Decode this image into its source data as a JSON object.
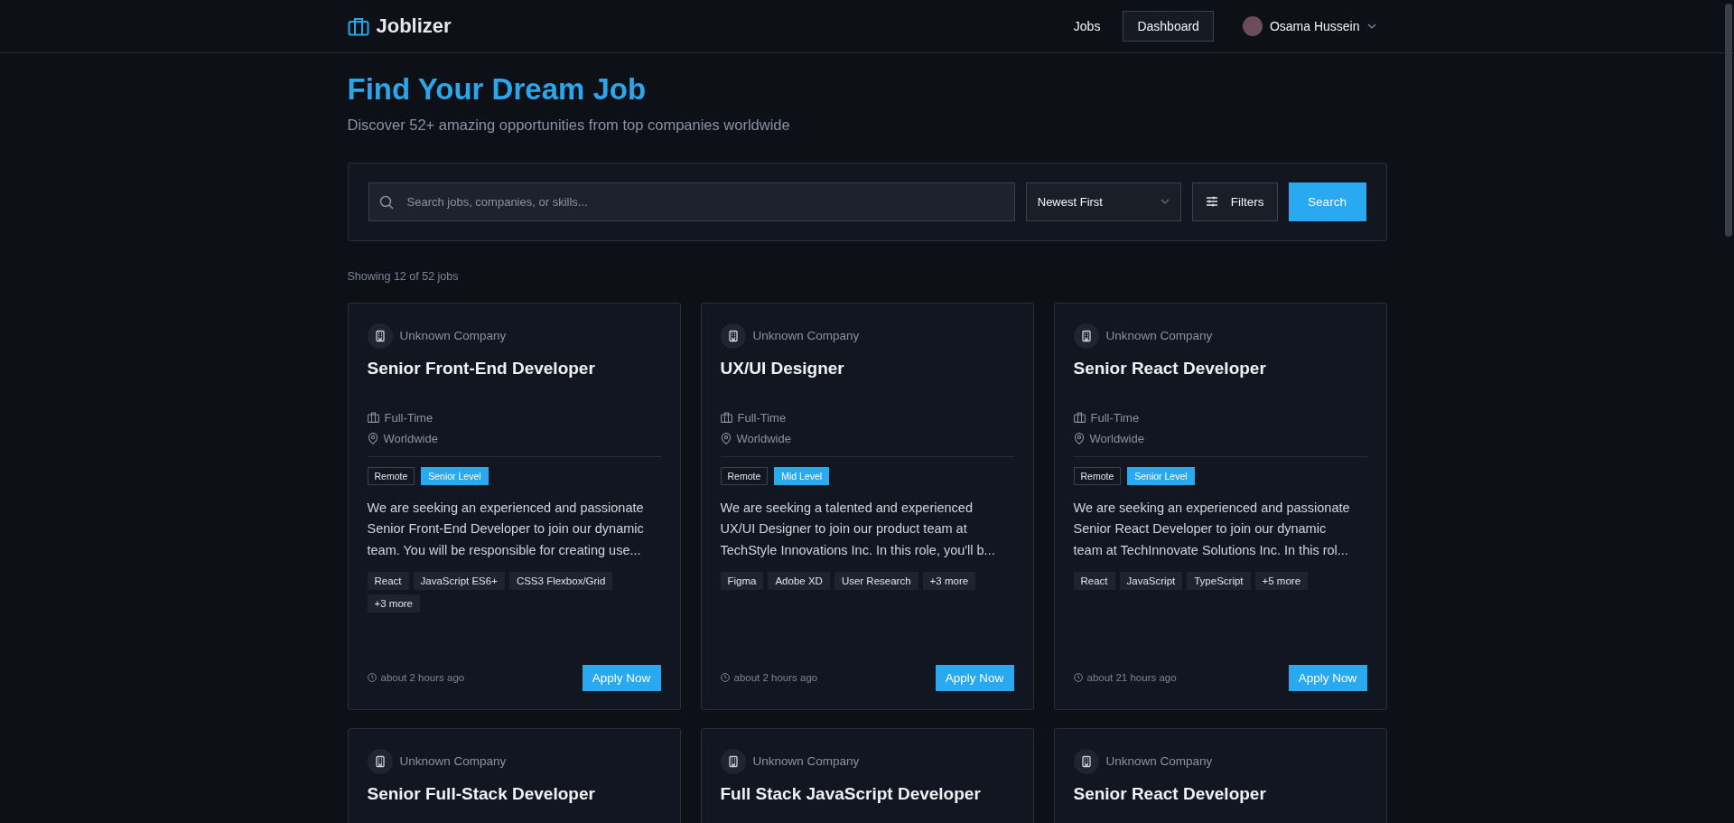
{
  "header": {
    "brand": "Joblizer",
    "nav": [
      {
        "label": "Jobs",
        "kind": "link"
      },
      {
        "label": "Dashboard",
        "kind": "outlined"
      }
    ],
    "user": {
      "name": "Osama Hussein"
    }
  },
  "hero": {
    "title": "Find Your Dream Job",
    "subtitle": "Discover 52+ amazing opportunities from top companies worldwide"
  },
  "search": {
    "placeholder": "Search jobs, companies, or skills...",
    "sort": "Newest First",
    "filters_label": "Filters",
    "search_label": "Search"
  },
  "results_count": "Showing 12 of 52 jobs",
  "jobs": [
    {
      "company": "Unknown Company",
      "title": "Senior Front-End Developer",
      "type": "Full-Time",
      "location": "Worldwide",
      "badges": [
        {
          "label": "Remote",
          "kind": "outline"
        },
        {
          "label": "Senior Level",
          "kind": "level"
        }
      ],
      "description_lines": [
        "We are seeking an experienced and passionate",
        "Senior Front-End Developer to join our dynamic",
        "team. You will be responsible for creating use..."
      ],
      "skills": [
        "React",
        "JavaScript ES6+",
        "CSS3 Flexbox/Grid",
        "+3 more"
      ],
      "posted": "about 2 hours ago",
      "apply_label": "Apply Now"
    },
    {
      "company": "Unknown Company",
      "title": "UX/UI Designer",
      "type": "Full-Time",
      "location": "Worldwide",
      "badges": [
        {
          "label": "Remote",
          "kind": "outline"
        },
        {
          "label": "Mid Level",
          "kind": "level"
        }
      ],
      "description_lines": [
        "We are seeking a talented and experienced",
        "UX/UI Designer to join our product team at",
        "TechStyle Innovations Inc. In this role, you'll b..."
      ],
      "skills": [
        "Figma",
        "Adobe XD",
        "User Research",
        "+3 more"
      ],
      "posted": "about 2 hours ago",
      "apply_label": "Apply Now"
    },
    {
      "company": "Unknown Company",
      "title": "Senior React Developer",
      "type": "Full-Time",
      "location": "Worldwide",
      "badges": [
        {
          "label": "Remote",
          "kind": "outline"
        },
        {
          "label": "Senior Level",
          "kind": "level"
        }
      ],
      "description_lines": [
        "We are seeking an experienced and passionate",
        "Senior React Developer to join our dynamic",
        "team at TechInnovate Solutions Inc. In this rol..."
      ],
      "skills": [
        "React",
        "JavaScript",
        "TypeScript",
        "+5 more"
      ],
      "posted": "about 21 hours ago",
      "apply_label": "Apply Now"
    },
    {
      "company": "Unknown Company",
      "title": "Senior Full-Stack Developer"
    },
    {
      "company": "Unknown Company",
      "title": "Full Stack JavaScript Developer"
    },
    {
      "company": "Unknown Company",
      "title": "Senior React Developer"
    }
  ]
}
